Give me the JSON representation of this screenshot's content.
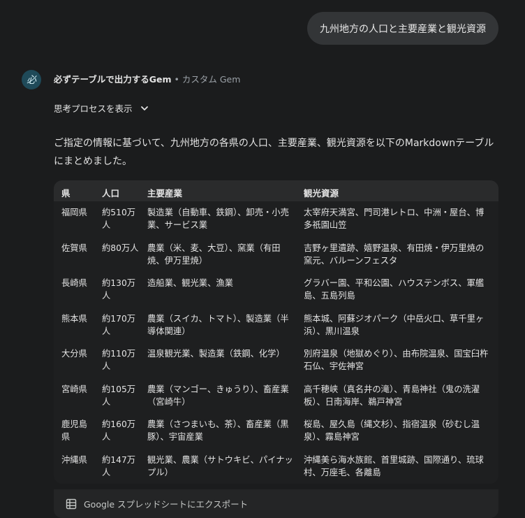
{
  "user_message": "九州地方の人口と主要産業と観光資源",
  "gem": {
    "avatar_glyph": "必",
    "name": "必ずテーブルで出力するGem",
    "separator": " • ",
    "type": "カスタム Gem"
  },
  "thinking": {
    "label": "思考プロセスを表示"
  },
  "intro_text": "ご指定の情報に基づいて、九州地方の各県の人口、主要産業、観光資源を以下のMarkdownテーブルにまとめました。",
  "table": {
    "headers": [
      "県",
      "人口",
      "主要産業",
      "観光資源"
    ],
    "rows": [
      [
        "福岡県",
        "約510万人",
        "製造業（自動車、鉄鋼）、卸売・小売業、サービス業",
        "太宰府天満宮、門司港レトロ、中洲・屋台、博多祇園山笠"
      ],
      [
        "佐賀県",
        "約80万人",
        "農業（米、麦、大豆）、窯業（有田焼、伊万里焼）",
        "吉野ヶ里遺跡、嬉野温泉、有田焼・伊万里焼の窯元、バルーンフェスタ"
      ],
      [
        "長崎県",
        "約130万人",
        "造船業、観光業、漁業",
        "グラバー園、平和公園、ハウステンボス、軍艦島、五島列島"
      ],
      [
        "熊本県",
        "約170万人",
        "農業（スイカ、トマト）、製造業（半導体関連）",
        "熊本城、阿蘇ジオパーク（中岳火口、草千里ヶ浜）、黒川温泉"
      ],
      [
        "大分県",
        "約110万人",
        "温泉観光業、製造業（鉄鋼、化学）",
        "別府温泉（地獄めぐり）、由布院温泉、国宝臼杵石仏、宇佐神宮"
      ],
      [
        "宮崎県",
        "約105万人",
        "農業（マンゴー、きゅうり）、畜産業（宮崎牛）",
        "高千穂峡（真名井の滝）、青島神社（鬼の洗濯板）、日南海岸、鵜戸神宮"
      ],
      [
        "鹿児島県",
        "約160万人",
        "農業（さつまいも、茶）、畜産業（黒豚）、宇宙産業",
        "桜島、屋久島（縄文杉）、指宿温泉（砂むし温泉）、霧島神宮"
      ],
      [
        "沖縄県",
        "約147万人",
        "観光業、農業（サトウキビ、パイナップル）",
        "沖縄美ら海水族館、首里城跡、国際通り、琉球村、万座毛、各離島"
      ]
    ]
  },
  "export": {
    "icon": "spreadsheet-icon",
    "label": "Google スプレッドシートにエクスポート"
  }
}
